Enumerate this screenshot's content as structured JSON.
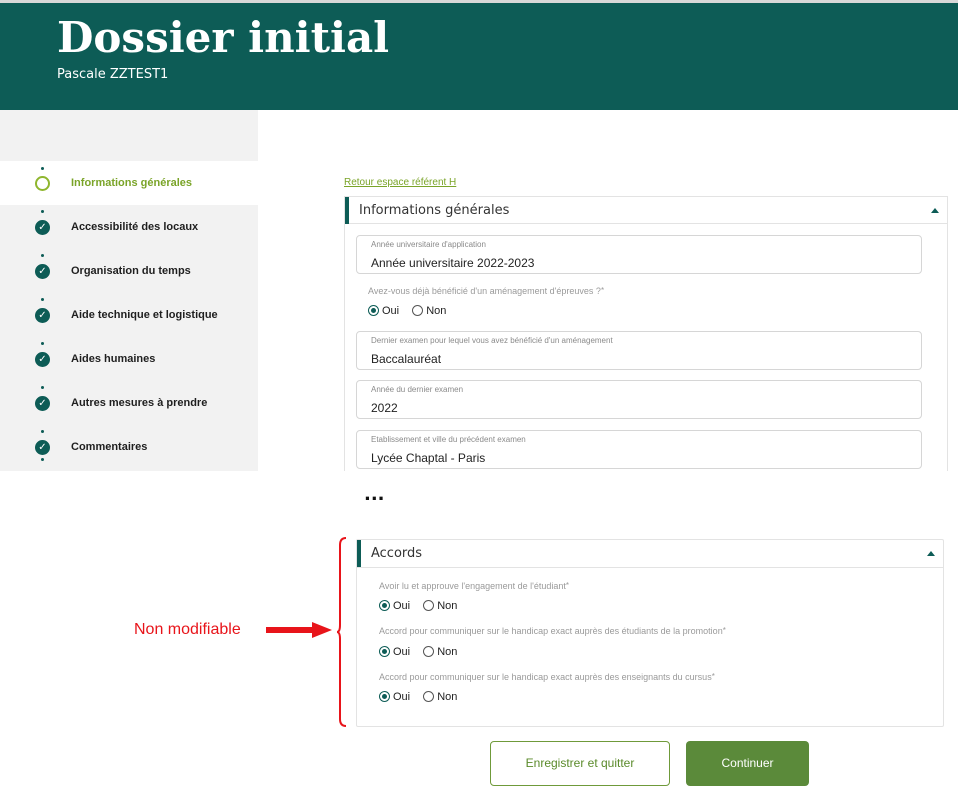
{
  "header": {
    "title": "Dossier initial",
    "subtitle": "Pascale ZZTEST1"
  },
  "sidebar": {
    "steps": [
      {
        "label": "Informations générales",
        "state": "current"
      },
      {
        "label": "Accessibilité des locaux",
        "state": "done"
      },
      {
        "label": "Organisation du temps",
        "state": "done"
      },
      {
        "label": "Aide technique et logistique",
        "state": "done"
      },
      {
        "label": "Aides humaines",
        "state": "done"
      },
      {
        "label": "Autres mesures à prendre",
        "state": "done"
      },
      {
        "label": "Commentaires",
        "state": "done"
      }
    ],
    "check_glyph": "✓"
  },
  "main": {
    "back_link": "Retour espace référent H",
    "general": {
      "title": "Informations générales",
      "fields": [
        {
          "label": "Année universitaire d'application",
          "value": "Année universitaire 2022-2023"
        },
        {
          "label": "Dernier examen pour lequel vous avez bénéficié d'un aménagement",
          "value": "Baccalauréat"
        },
        {
          "label": "Année du dernier examen",
          "value": "2022"
        },
        {
          "label": "Etablissement et ville du précédent examen",
          "value": "Lycée Chaptal - Paris"
        }
      ],
      "question": {
        "label": "Avez-vous déjà bénéficié d'un aménagement d'épreuves ?",
        "required": "*",
        "yes": "Oui",
        "no": "Non",
        "selected": "Oui"
      }
    },
    "ellipsis": "...",
    "accords": {
      "title": "Accords",
      "questions": [
        {
          "label": "Avoir lu et approuve l'engagement de l'étudiant",
          "required": "*",
          "yes": "Oui",
          "no": "Non",
          "selected": "Oui"
        },
        {
          "label": "Accord pour communiquer sur le handicap exact auprès des étudiants de la promotion",
          "required": "*",
          "yes": "Oui",
          "no": "Non",
          "selected": "Oui"
        },
        {
          "label": "Accord pour communiquer sur le handicap exact auprès des enseignants du cursus",
          "required": "*",
          "yes": "Oui",
          "no": "Non",
          "selected": "Oui"
        }
      ]
    }
  },
  "annotation": {
    "text": "Non modifiable",
    "color": "#e8141a"
  },
  "buttons": {
    "save": "Enregistrer et quitter",
    "continue": "Continuer"
  },
  "colors": {
    "brand": "#0d5c56",
    "accent": "#7aa428",
    "button": "#5b8a3a"
  }
}
